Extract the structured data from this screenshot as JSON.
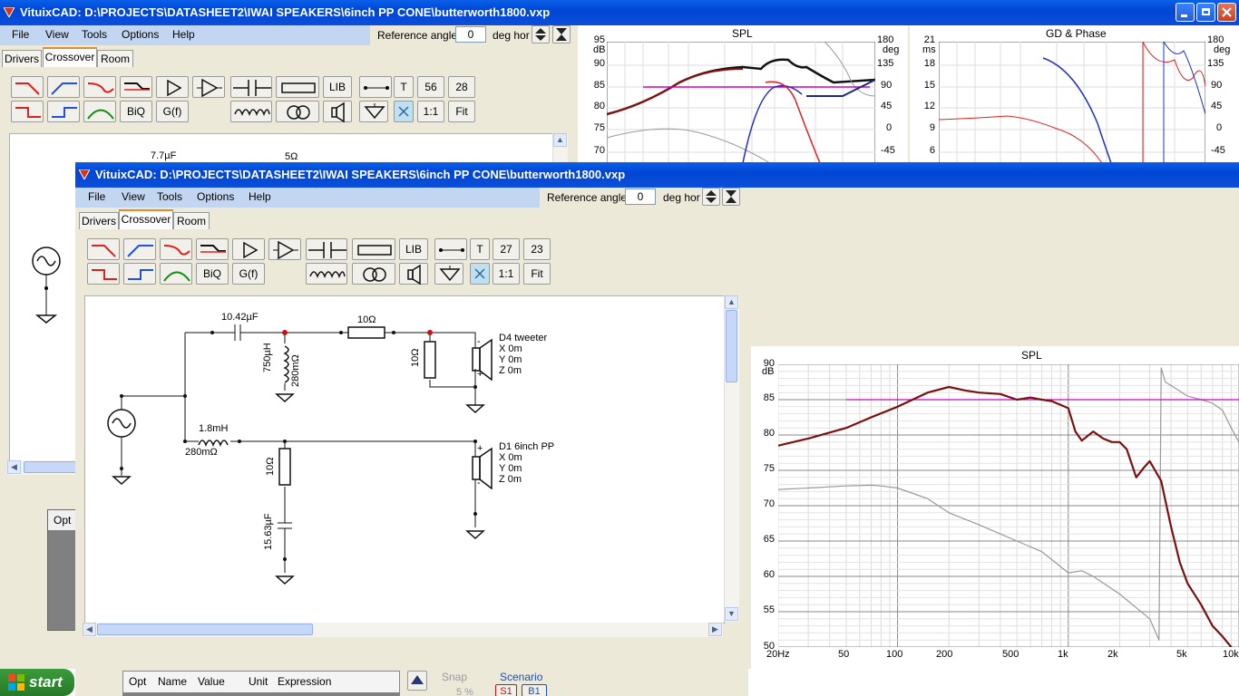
{
  "back_window": {
    "title": "VituixCAD: D:\\PROJECTS\\DATASHEET2\\IWAI SPEAKERS\\6inch PP CONE\\butterworth1800.vxp",
    "menu": [
      "File",
      "View",
      "Tools",
      "Options",
      "Help"
    ],
    "reference_angle_label": "Reference angle",
    "reference_angle_value": "0",
    "deg_hor_label": "deg hor",
    "tabs": [
      "Drivers",
      "Crossover",
      "Room"
    ],
    "toolbar": {
      "lib": "LIB",
      "t": "T",
      "n1": "56",
      "n2": "28",
      "biq": "BiQ",
      "gf": "G(f)",
      "one": "1:1",
      "fit": "Fit"
    },
    "schematic_labels": {
      "cap": "7.7µF",
      "res": "5Ω"
    },
    "opt_header": "Opt",
    "spl_chart": {
      "title": "SPL",
      "left_unit": "dB",
      "right_unit": "deg",
      "left_ticks": [
        "95",
        "90",
        "85",
        "80",
        "75",
        "70"
      ],
      "right_ticks": [
        "180",
        "135",
        "90",
        "45",
        "0",
        "-45"
      ]
    },
    "gd_chart": {
      "title": "GD & Phase",
      "left_unit": "ms",
      "right_unit": "deg",
      "left_ticks": [
        "21",
        "18",
        "15",
        "12",
        "9",
        "6"
      ],
      "right_ticks": [
        "180",
        "135",
        "90",
        "45",
        "0",
        "-45"
      ]
    }
  },
  "front_window": {
    "title": "VituixCAD: D:\\PROJECTS\\DATASHEET2\\IWAI SPEAKERS\\6inch PP CONE\\butterworth1800.vxp",
    "menu": [
      "File",
      "View",
      "Tools",
      "Options",
      "Help"
    ],
    "reference_angle_label": "Reference angle",
    "reference_angle_value": "0",
    "deg_hor_label": "deg hor",
    "tabs": [
      "Drivers",
      "Crossover",
      "Room"
    ],
    "toolbar": {
      "lib": "LIB",
      "t": "T",
      "n1": "27",
      "n2": "23",
      "biq": "BiQ",
      "gf": "G(f)",
      "one": "1:1",
      "fit": "Fit"
    },
    "schematic": {
      "c1": "10.42µF",
      "l1": "750µH",
      "l1r": "280mΩ",
      "r1": "10Ω",
      "r2": "10Ω",
      "l2": "1.8mH",
      "l2r": "280mΩ",
      "r3": "10Ω",
      "c2": "15.63µF",
      "tweeter": {
        "name": "D4 tweeter",
        "x": "X 0m",
        "y": "Y 0m",
        "z": "Z 0m"
      },
      "woofer": {
        "name": "D1 6inch PP",
        "x": "X 0m",
        "y": "Y 0m",
        "z": "Z 0m"
      },
      "plus": "+",
      "minus": "-"
    },
    "table_headers": [
      "Opt",
      "Name",
      "Value",
      "Unit",
      "Expression"
    ],
    "snap_label": "Snap",
    "snap_value": "5 %",
    "scenario_label": "Scenario",
    "scenario_buttons": [
      "S1",
      "B1"
    ]
  },
  "main_chart": {
    "title": "SPL",
    "unit": "dB",
    "y_ticks": [
      "90",
      "85",
      "80",
      "75",
      "70",
      "65",
      "60",
      "55",
      "50"
    ],
    "x_ticks": [
      "20Hz",
      "50",
      "100",
      "200",
      "500",
      "1k",
      "2k",
      "5k",
      "10k"
    ]
  },
  "chart_data": {
    "type": "line",
    "title": "SPL",
    "xlabel": "",
    "ylabel": "dB",
    "x_scale": "log",
    "xlim": [
      20,
      10000
    ],
    "ylim": [
      50,
      90
    ],
    "grid": true,
    "series": [
      {
        "color": "#7a1010",
        "x": [
          20,
          30,
          50,
          70,
          100,
          150,
          200,
          250,
          300,
          400,
          500,
          600,
          700,
          800,
          1000,
          1100,
          1200,
          1400,
          1600,
          1800,
          2000,
          2200,
          2500,
          2800,
          3000,
          3500,
          4000,
          4500,
          5000,
          6000,
          7000,
          8000,
          9000,
          10000
        ],
        "y": [
          78.5,
          79.5,
          81,
          82.5,
          84,
          86,
          86.8,
          86.3,
          86,
          85.8,
          85,
          85.3,
          85,
          84.8,
          83.8,
          80.5,
          79.2,
          80.5,
          79.5,
          79,
          79,
          78,
          74,
          75.5,
          76.3,
          73.5,
          67,
          62,
          59,
          56,
          53,
          51.5,
          50,
          49
        ]
      },
      {
        "color": "#999999",
        "x": [
          20,
          30,
          50,
          70,
          80,
          100,
          150,
          200,
          300,
          400,
          500,
          700,
          1000,
          1200,
          1400,
          2000,
          3000,
          3400,
          3500,
          3700,
          4000,
          5000,
          6000,
          7000,
          8000,
          9000,
          10000
        ],
        "y": [
          72.3,
          72.5,
          72.8,
          72.9,
          72.8,
          72.5,
          71,
          69,
          67.3,
          66,
          65,
          63.5,
          60.5,
          60.8,
          60,
          57.5,
          54,
          51,
          89.5,
          87.5,
          87,
          85.5,
          85,
          84.5,
          83.5,
          81,
          79
        ]
      },
      {
        "color": "#cc00cc",
        "x": [
          50,
          10000
        ],
        "y": [
          85,
          85
        ]
      }
    ]
  }
}
